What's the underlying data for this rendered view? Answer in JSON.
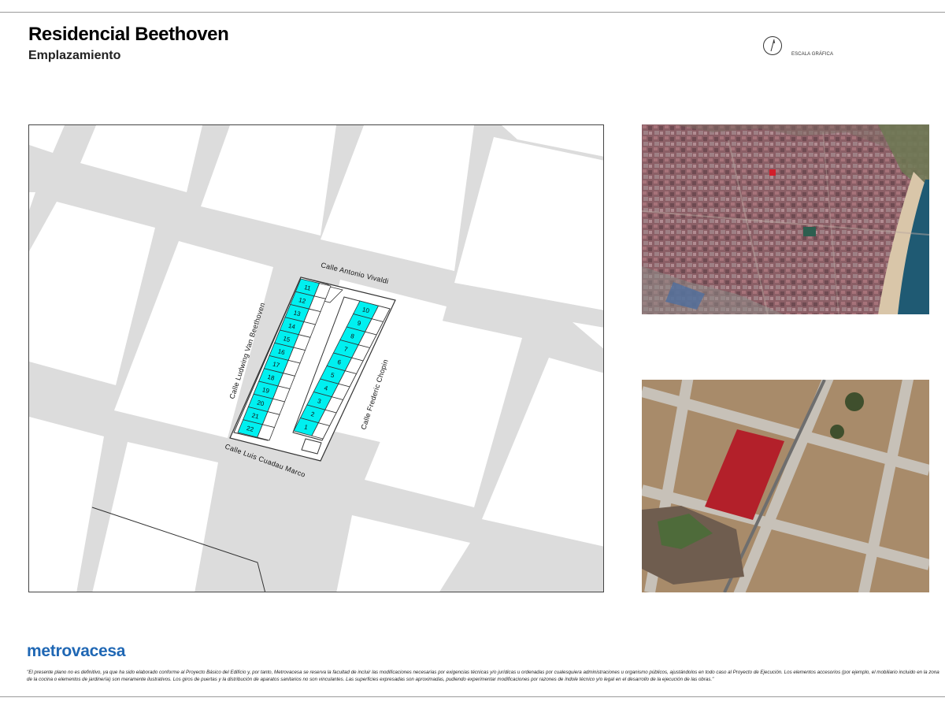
{
  "header": {
    "title": "Residencial Beethoven",
    "subtitle": "Emplazamiento",
    "scale_label": "ESCALA GRÁFICA"
  },
  "map": {
    "streets": {
      "north": "Calle Antonio Vivaldi",
      "west": "Calle Ludwing Van Beethoven",
      "east": "Calle Frederic Chopin",
      "south": "Calle Luis Cuadau Marco"
    },
    "lots_west": [
      "11",
      "12",
      "13",
      "14",
      "15",
      "16",
      "17",
      "18",
      "19",
      "20",
      "21",
      "22"
    ],
    "lots_east": [
      "10",
      "9",
      "8",
      "7",
      "6",
      "5",
      "4",
      "3",
      "2",
      "1"
    ],
    "colors": {
      "road": "#dcdcdc",
      "block": "#ffffff",
      "lot_fill": "#00f0f0",
      "site_highlight": "#b3202a"
    }
  },
  "footer": {
    "brand": "metrovacesa",
    "brand_color": "#1f67b4",
    "disclaimer": "\"El presente plano no es definitivo, ya que ha sido elaborado conforme al Proyecto Básico del Edificio y, por tanto, Metrovacesa se reserva la facultad de incluir las modificaciones necesarias por exigencias técnicas y/o jurídicas u ordenadas por cualesquiera administraciones u organismo públicos, ajustándolos en todo caso al Proyecto de Ejecución. Los elementos accesorios (por ejemplo, el mobiliario incluido en la zona de la cocina o elementos de jardinería) son meramente ilustrativos. Los giros de puertas y la distribución de aparatos sanitarios no son vinculantes. Las superficies expresadas son aproximadas, pudiendo experimentar modificaciones por razones de índole técnico y/o legal en el desarrollo de la ejecución de las obras.\""
  }
}
